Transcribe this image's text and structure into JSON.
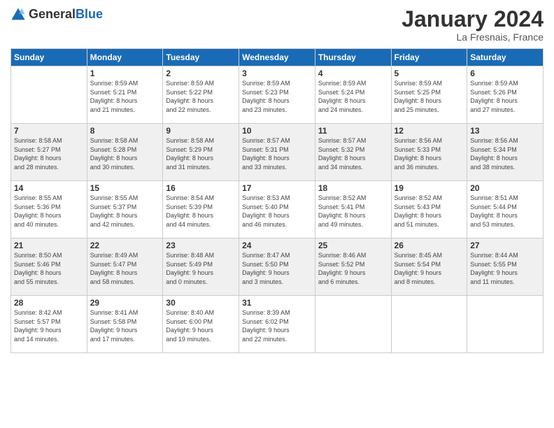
{
  "header": {
    "logo_general": "General",
    "logo_blue": "Blue",
    "month_title": "January 2024",
    "subtitle": "La Fresnais, France"
  },
  "days_of_week": [
    "Sunday",
    "Monday",
    "Tuesday",
    "Wednesday",
    "Thursday",
    "Friday",
    "Saturday"
  ],
  "weeks": [
    [
      {
        "day": "",
        "info": ""
      },
      {
        "day": "1",
        "info": "Sunrise: 8:59 AM\nSunset: 5:21 PM\nDaylight: 8 hours\nand 21 minutes."
      },
      {
        "day": "2",
        "info": "Sunrise: 8:59 AM\nSunset: 5:22 PM\nDaylight: 8 hours\nand 22 minutes."
      },
      {
        "day": "3",
        "info": "Sunrise: 8:59 AM\nSunset: 5:23 PM\nDaylight: 8 hours\nand 23 minutes."
      },
      {
        "day": "4",
        "info": "Sunrise: 8:59 AM\nSunset: 5:24 PM\nDaylight: 8 hours\nand 24 minutes."
      },
      {
        "day": "5",
        "info": "Sunrise: 8:59 AM\nSunset: 5:25 PM\nDaylight: 8 hours\nand 25 minutes."
      },
      {
        "day": "6",
        "info": "Sunrise: 8:59 AM\nSunset: 5:26 PM\nDaylight: 8 hours\nand 27 minutes."
      }
    ],
    [
      {
        "day": "7",
        "info": "Sunrise: 8:58 AM\nSunset: 5:27 PM\nDaylight: 8 hours\nand 28 minutes."
      },
      {
        "day": "8",
        "info": "Sunrise: 8:58 AM\nSunset: 5:28 PM\nDaylight: 8 hours\nand 30 minutes."
      },
      {
        "day": "9",
        "info": "Sunrise: 8:58 AM\nSunset: 5:29 PM\nDaylight: 8 hours\nand 31 minutes."
      },
      {
        "day": "10",
        "info": "Sunrise: 8:57 AM\nSunset: 5:31 PM\nDaylight: 8 hours\nand 33 minutes."
      },
      {
        "day": "11",
        "info": "Sunrise: 8:57 AM\nSunset: 5:32 PM\nDaylight: 8 hours\nand 34 minutes."
      },
      {
        "day": "12",
        "info": "Sunrise: 8:56 AM\nSunset: 5:33 PM\nDaylight: 8 hours\nand 36 minutes."
      },
      {
        "day": "13",
        "info": "Sunrise: 8:56 AM\nSunset: 5:34 PM\nDaylight: 8 hours\nand 38 minutes."
      }
    ],
    [
      {
        "day": "14",
        "info": "Sunrise: 8:55 AM\nSunset: 5:36 PM\nDaylight: 8 hours\nand 40 minutes."
      },
      {
        "day": "15",
        "info": "Sunrise: 8:55 AM\nSunset: 5:37 PM\nDaylight: 8 hours\nand 42 minutes."
      },
      {
        "day": "16",
        "info": "Sunrise: 8:54 AM\nSunset: 5:39 PM\nDaylight: 8 hours\nand 44 minutes."
      },
      {
        "day": "17",
        "info": "Sunrise: 8:53 AM\nSunset: 5:40 PM\nDaylight: 8 hours\nand 46 minutes."
      },
      {
        "day": "18",
        "info": "Sunrise: 8:52 AM\nSunset: 5:41 PM\nDaylight: 8 hours\nand 49 minutes."
      },
      {
        "day": "19",
        "info": "Sunrise: 8:52 AM\nSunset: 5:43 PM\nDaylight: 8 hours\nand 51 minutes."
      },
      {
        "day": "20",
        "info": "Sunrise: 8:51 AM\nSunset: 5:44 PM\nDaylight: 8 hours\nand 53 minutes."
      }
    ],
    [
      {
        "day": "21",
        "info": "Sunrise: 8:50 AM\nSunset: 5:46 PM\nDaylight: 8 hours\nand 55 minutes."
      },
      {
        "day": "22",
        "info": "Sunrise: 8:49 AM\nSunset: 5:47 PM\nDaylight: 8 hours\nand 58 minutes."
      },
      {
        "day": "23",
        "info": "Sunrise: 8:48 AM\nSunset: 5:49 PM\nDaylight: 9 hours\nand 0 minutes."
      },
      {
        "day": "24",
        "info": "Sunrise: 8:47 AM\nSunset: 5:50 PM\nDaylight: 9 hours\nand 3 minutes."
      },
      {
        "day": "25",
        "info": "Sunrise: 8:46 AM\nSunset: 5:52 PM\nDaylight: 9 hours\nand 6 minutes."
      },
      {
        "day": "26",
        "info": "Sunrise: 8:45 AM\nSunset: 5:54 PM\nDaylight: 9 hours\nand 8 minutes."
      },
      {
        "day": "27",
        "info": "Sunrise: 8:44 AM\nSunset: 5:55 PM\nDaylight: 9 hours\nand 11 minutes."
      }
    ],
    [
      {
        "day": "28",
        "info": "Sunrise: 8:42 AM\nSunset: 5:57 PM\nDaylight: 9 hours\nand 14 minutes."
      },
      {
        "day": "29",
        "info": "Sunrise: 8:41 AM\nSunset: 5:58 PM\nDaylight: 9 hours\nand 17 minutes."
      },
      {
        "day": "30",
        "info": "Sunrise: 8:40 AM\nSunset: 6:00 PM\nDaylight: 9 hours\nand 19 minutes."
      },
      {
        "day": "31",
        "info": "Sunrise: 8:39 AM\nSunset: 6:02 PM\nDaylight: 9 hours\nand 22 minutes."
      },
      {
        "day": "",
        "info": ""
      },
      {
        "day": "",
        "info": ""
      },
      {
        "day": "",
        "info": ""
      }
    ]
  ]
}
